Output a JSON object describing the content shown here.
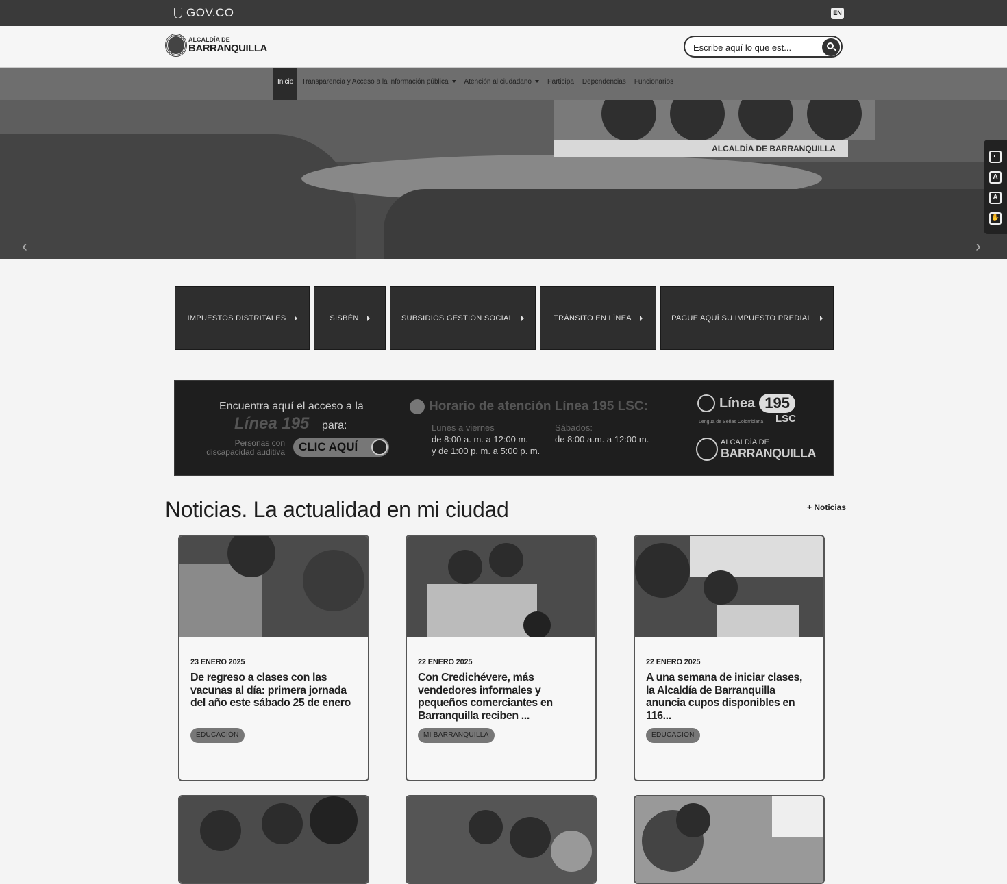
{
  "topbar": {
    "gov_label": "GOV.CO",
    "lang_label": "EN"
  },
  "header": {
    "logo_small": "ALCALDÍA DE",
    "logo_big": "BARRANQUILLA",
    "search_placeholder": "Escribe aquí lo que est..."
  },
  "nav": {
    "items": [
      {
        "label": "Inicio"
      },
      {
        "label": "Transparencia y Acceso a la información pública"
      },
      {
        "label": "Atención al ciudadano"
      },
      {
        "label": "Participa"
      },
      {
        "label": "Dependencias"
      },
      {
        "label": "Funcionarios"
      }
    ]
  },
  "hero": {
    "sign_text": "ALCALDÍA DE BARRANQUILLA",
    "prev": "‹",
    "next": "›"
  },
  "quick_links": [
    {
      "label": "IMPUESTOS DISTRITALES"
    },
    {
      "label": "SISBÉN"
    },
    {
      "label": "SUBSIDIOS GESTIÓN SOCIAL"
    },
    {
      "label": "TRÁNSITO EN LÍNEA"
    },
    {
      "label": "PAGUE AQUÍ SU IMPUESTO PREDIAL"
    }
  ],
  "banner": {
    "access_text": "Encuentra aquí el acceso a la",
    "line_name": "Línea 195",
    "para": "para:",
    "audience": "Personas con discapacidad auditiva",
    "cta": "CLIC AQUÍ",
    "schedule_title": "Horario de atención Línea 195 LSC:",
    "weekday_label": "Lunes a viernes",
    "weekday_hours_1": "de 8:00 a. m. a 12:00 m.",
    "weekday_hours_2": "y de 1:00 p. m. a 5:00 p. m.",
    "saturday_label": "Sábados:",
    "saturday_hours": "de 8:00 a.m. a 12:00 m.",
    "linea_word": "Línea",
    "linea_number": "195",
    "lsc": "LSC",
    "lsc_sub": "Lengua de Señas Colombiana",
    "alc_small": "ALCALDÍA DE",
    "alc_big": "BARRANQUILLA"
  },
  "news": {
    "title": "Noticias. La actualidad en mi ciudad",
    "more_link": "+ Noticias",
    "cards": [
      {
        "date": "23 ENERO 2025",
        "title": "De regreso a clases con las vacunas al día: primera jornada del año este sábado 25 de enero",
        "tag": "EDUCACIÓN"
      },
      {
        "date": "22 ENERO 2025",
        "title": "Con Credichévere, más vendedores informales y pequeños comerciantes en Barranquilla reciben ...",
        "tag": "MI BARRANQUILLA"
      },
      {
        "date": "22 ENERO 2025",
        "title": "A una semana de iniciar clases, la Alcaldía de Barranquilla anuncia cupos disponibles en 116...",
        "tag": "EDUCACIÓN"
      }
    ]
  },
  "accessibility": {
    "icons": [
      "contrast-icon",
      "decrease-text-icon",
      "increase-text-icon",
      "sign-language-icon"
    ]
  }
}
